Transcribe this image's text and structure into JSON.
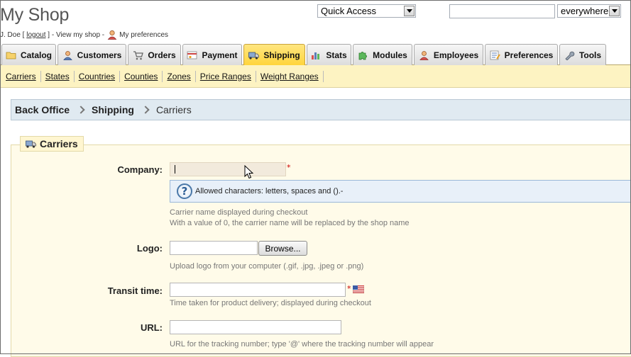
{
  "header": {
    "title": "My Shop",
    "user_name": "J. Doe",
    "logout_label": "logout",
    "view_shop_label": "View my shop",
    "preferences_label": "My preferences",
    "quick_access": "Quick Access",
    "search_value": "",
    "search_scope": "everywhere"
  },
  "tabs": [
    {
      "label": "Catalog",
      "icon": "folder-icon"
    },
    {
      "label": "Customers",
      "icon": "customer-icon"
    },
    {
      "label": "Orders",
      "icon": "cart-icon"
    },
    {
      "label": "Payment",
      "icon": "payment-icon"
    },
    {
      "label": "Shipping",
      "icon": "truck-icon",
      "active": true
    },
    {
      "label": "Stats",
      "icon": "chart-icon"
    },
    {
      "label": "Modules",
      "icon": "puzzle-icon"
    },
    {
      "label": "Employees",
      "icon": "employee-icon"
    },
    {
      "label": "Preferences",
      "icon": "preferences-icon"
    },
    {
      "label": "Tools",
      "icon": "wrench-icon"
    }
  ],
  "subnav": [
    "Carriers",
    "States",
    "Countries",
    "Counties",
    "Zones",
    "Price Ranges",
    "Weight Ranges"
  ],
  "breadcrumb": [
    "Back Office",
    "Shipping",
    "Carriers"
  ],
  "form": {
    "legend": "Carriers",
    "company": {
      "label": "Company:",
      "value": "",
      "help": "Allowed characters: letters, spaces and ().-",
      "hint1": "Carrier name displayed during checkout",
      "hint2": "With a value of 0, the carrier name will be replaced by the shop name"
    },
    "logo": {
      "label": "Logo:",
      "browse": "Browse...",
      "hint": "Upload logo from your computer (.gif, .jpg, .jpeg or .png)"
    },
    "transit": {
      "label": "Transit time:",
      "value": "",
      "hint": "Time taken for product delivery; displayed during checkout"
    },
    "url": {
      "label": "URL:",
      "value": "",
      "hint": "URL for the tracking number; type '@' where the tracking number will appear"
    },
    "required_mark": "*"
  },
  "colors": {
    "active_tab": "#ffd43a",
    "subnav_bg": "#fdf3c2",
    "breadcrumb_bg": "#e0eaf1",
    "panel_bg": "#fffbe9"
  }
}
